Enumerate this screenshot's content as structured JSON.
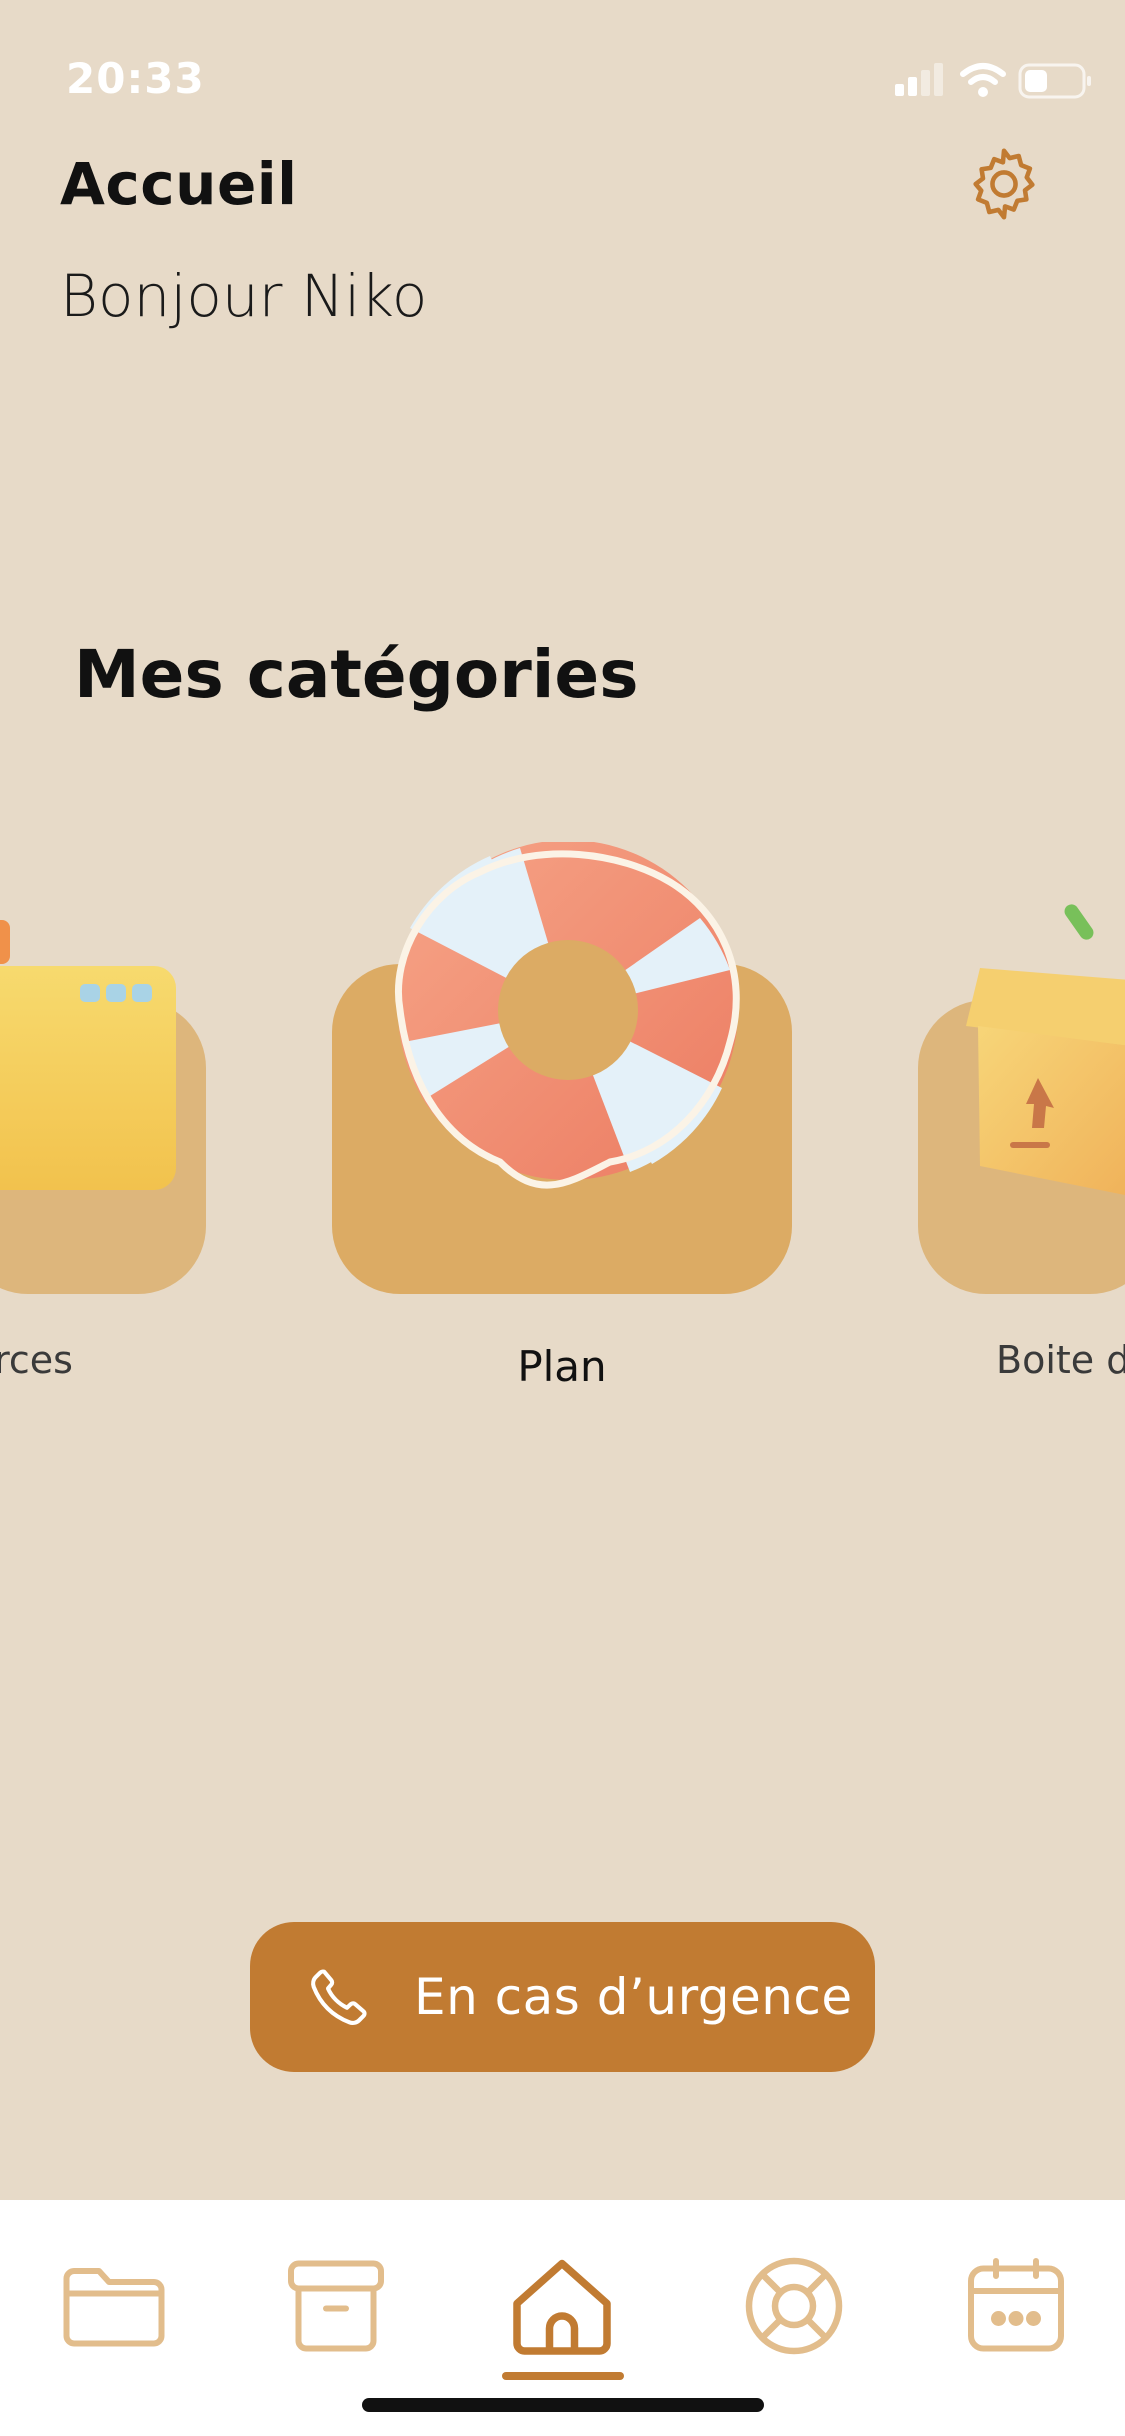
{
  "status_bar": {
    "time": "20:33"
  },
  "header": {
    "title": "Accueil",
    "greeting": "Bonjour Niko",
    "settings_icon": "gear-icon"
  },
  "categories": {
    "title": "Mes catégories",
    "items": [
      {
        "label": "urces",
        "icon": "folder-illustration"
      },
      {
        "label": "Plan",
        "icon": "lifebuoy-illustration",
        "selected": true
      },
      {
        "label": "Boite d",
        "icon": "box-illustration"
      }
    ]
  },
  "emergency_button": {
    "label": "En cas d’urgence",
    "icon": "phone-icon"
  },
  "tabbar": {
    "items": [
      {
        "icon": "folder-icon"
      },
      {
        "icon": "archive-box-icon"
      },
      {
        "icon": "home-icon",
        "active": true
      },
      {
        "icon": "lifebuoy-icon"
      },
      {
        "icon": "calendar-icon"
      }
    ]
  },
  "colors": {
    "background": "#e7dac8",
    "accent": "#c17b32",
    "card": "#dcab64",
    "tab_icon_inactive": "#e2bd8c"
  }
}
